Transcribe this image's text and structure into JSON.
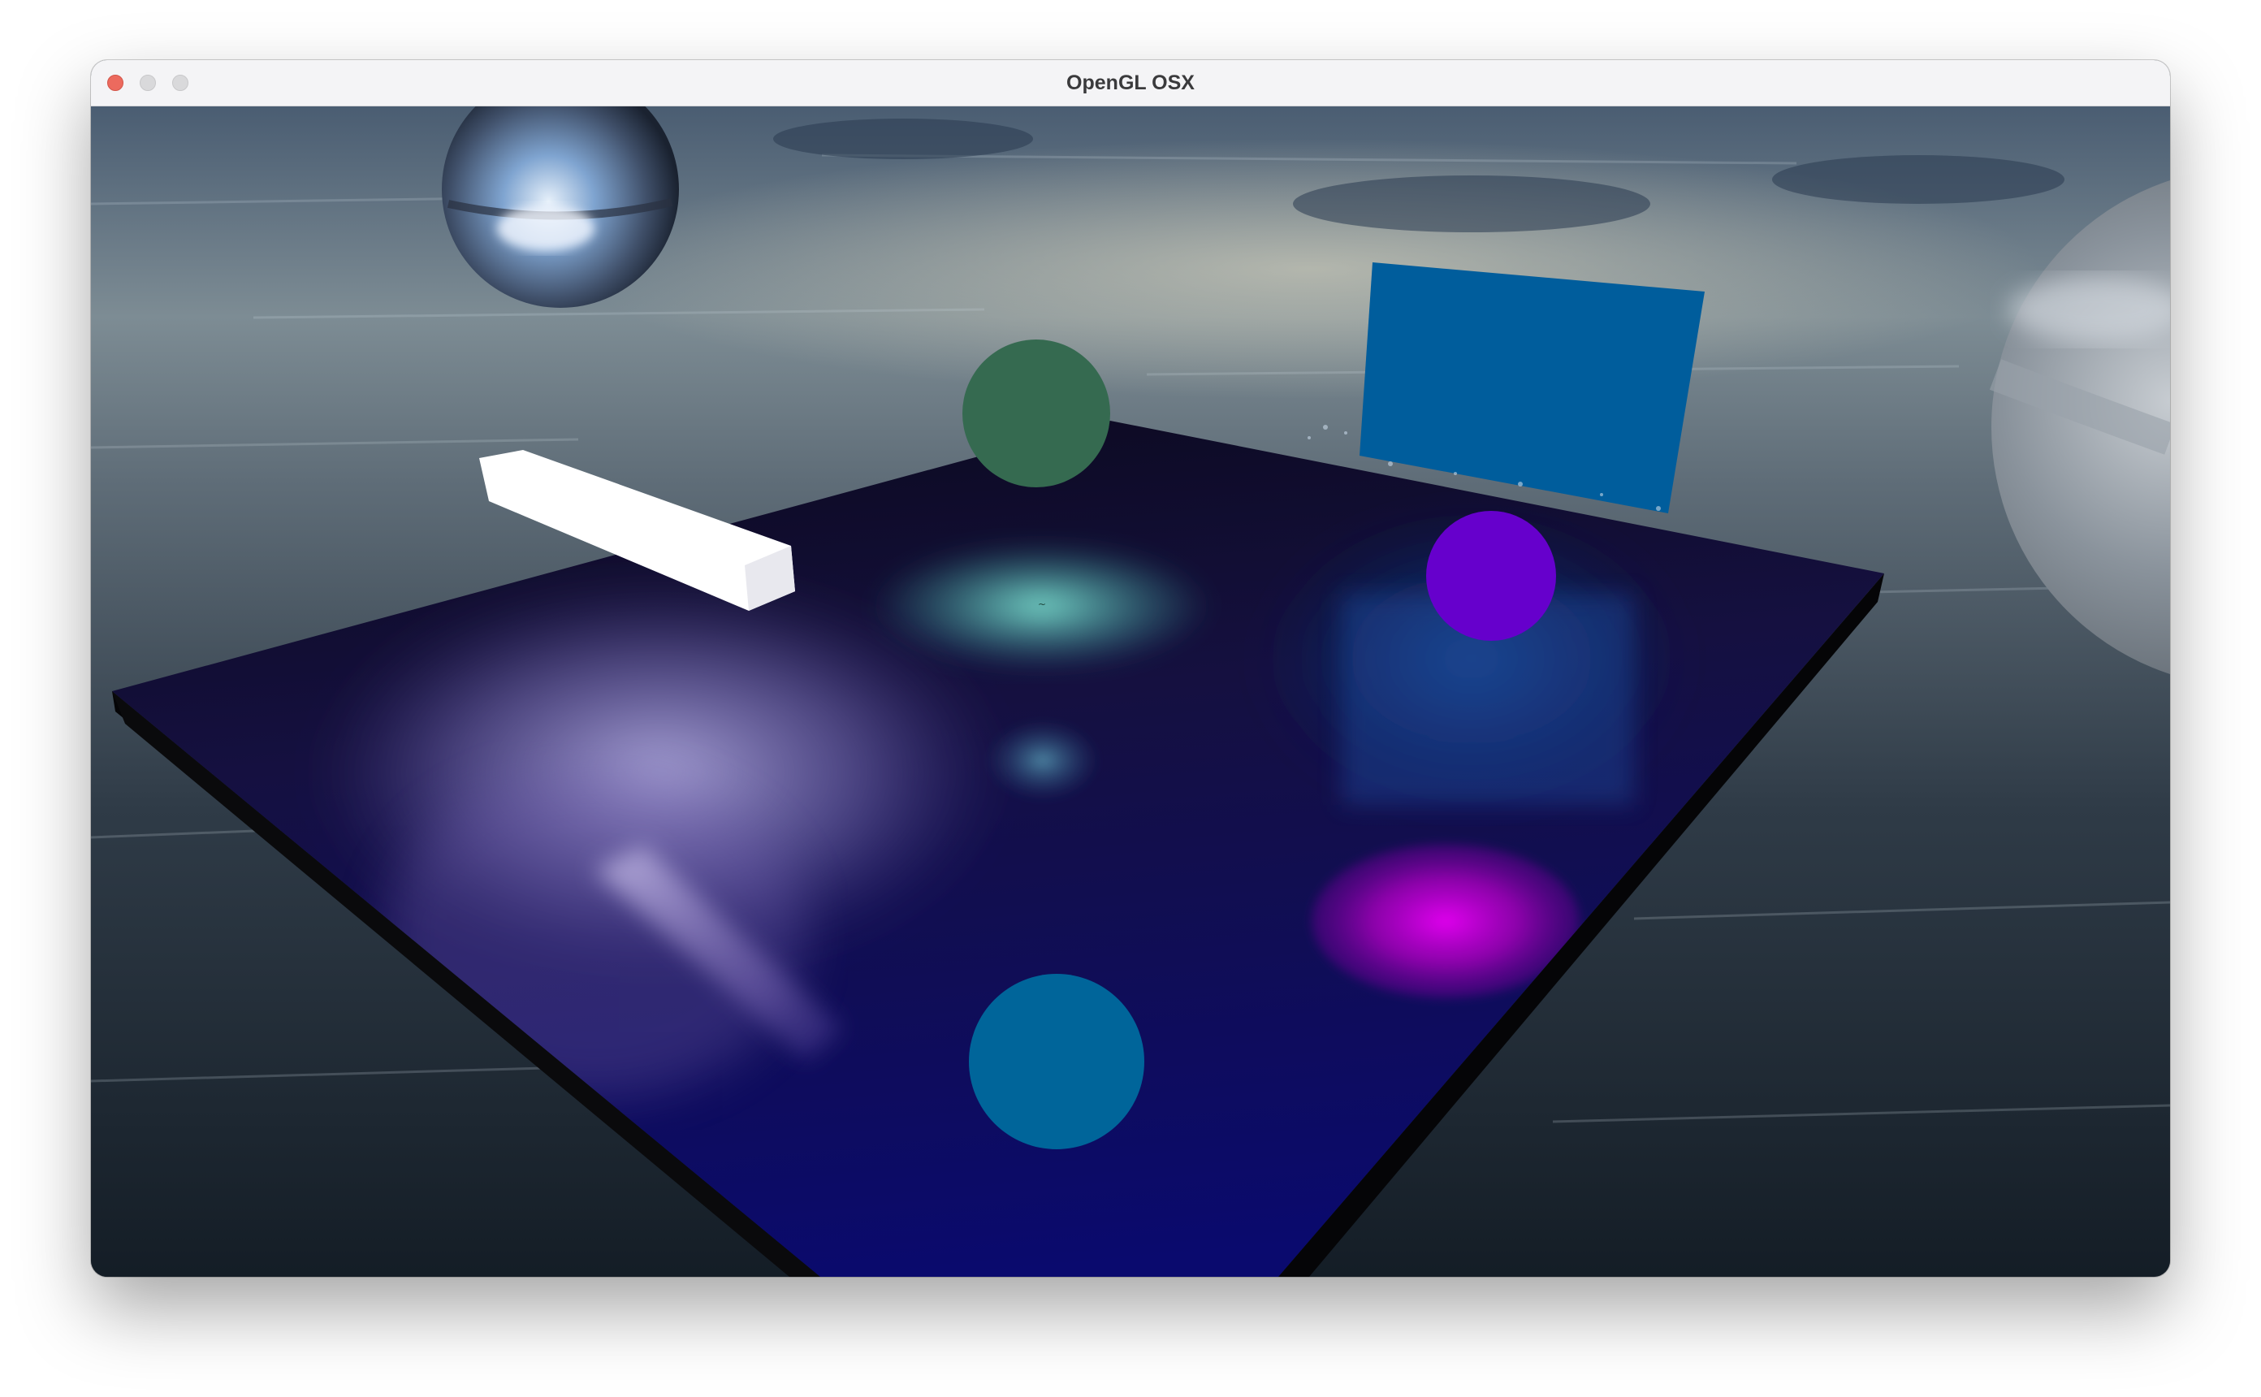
{
  "window": {
    "title": "OpenGL OSX",
    "controls": [
      "close",
      "minimize",
      "zoom"
    ]
  },
  "scene": {
    "description_type": "opengl-render",
    "colors": {
      "floor_near": "#0a0a6e",
      "floor_far": "#0c0a20",
      "green_sphere": "#356a50",
      "purple_sphere": "#6600cc",
      "teal_sphere": "#00659a",
      "blue_panel": "#005d9c",
      "white_bar": "#ffffff",
      "magenta_light": "#e000ee",
      "cyan_light": "#7de0d0",
      "lavender_light": "#b4aee0"
    }
  }
}
